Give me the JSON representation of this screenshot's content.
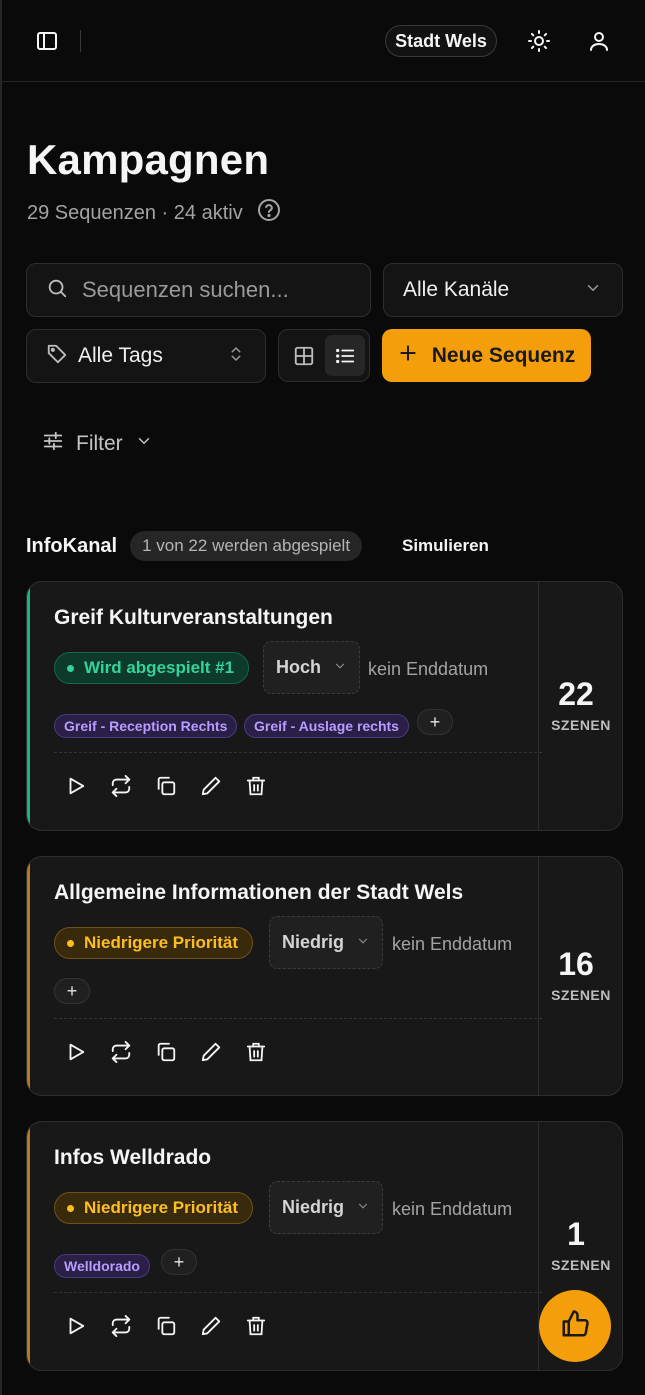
{
  "header": {
    "org_name": "Stadt Wels",
    "icons": {
      "sidebar": "sidebar-toggle-icon",
      "theme": "sun-icon",
      "user": "user-icon"
    }
  },
  "page": {
    "title": "Kampagnen",
    "subtitle": "29 Sequenzen · 24 aktiv"
  },
  "toolbar": {
    "search_placeholder": "Sequenzen suchen...",
    "channel_select": "Alle Kanäle",
    "tags_select": "Alle Tags",
    "new_button": "Neue Sequenz",
    "filter_label": "Filter"
  },
  "section": {
    "title": "InfoKanal",
    "count": "1 von 22 werden abgespielt",
    "simulate": "Simulieren"
  },
  "colors": {
    "accent": "#f59e0b",
    "playing": "#34d399",
    "low_priority": "#fbbf24",
    "tag": "#b99cff"
  },
  "cards": [
    {
      "title": "Greif Kulturveranstaltungen",
      "status": "Wird abgespielt #1",
      "priority": "Hoch",
      "end_date": "kein Enddatum",
      "tags": [
        "Greif - Reception Rechts",
        "Greif - Auslage rechts"
      ],
      "scenes": "22",
      "scenes_label": "SZENEN"
    },
    {
      "title": "Allgemeine Informationen der Stadt Wels",
      "status": "Niedrigere Priorität",
      "priority": "Niedrig",
      "end_date": "kein Enddatum",
      "tags": [],
      "scenes": "16",
      "scenes_label": "SZENEN"
    },
    {
      "title": "Infos Welldrado",
      "status": "Niedrigere Priorität",
      "priority": "Niedrig",
      "end_date": "kein Enddatum",
      "tags": [
        "Welldorado"
      ],
      "scenes": "1",
      "scenes_label": "SZENEN"
    }
  ]
}
